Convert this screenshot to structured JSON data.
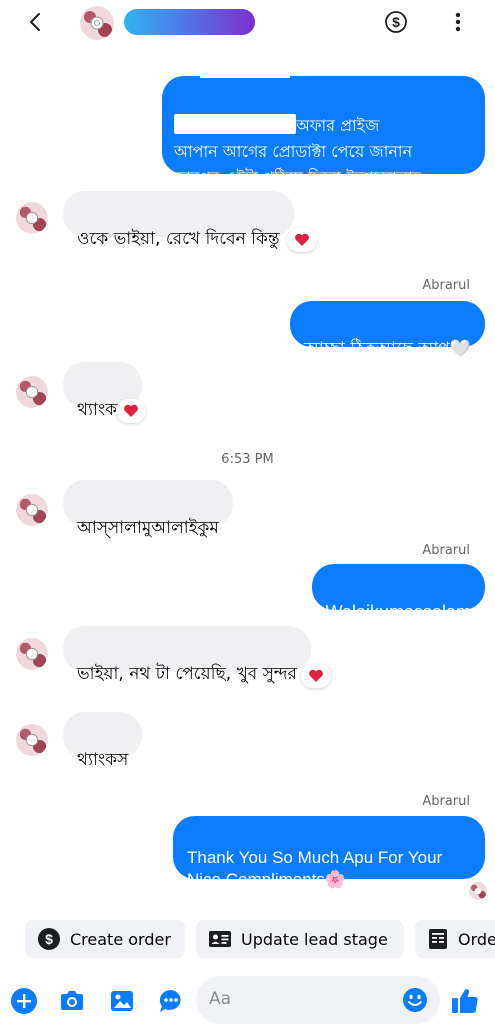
{
  "header": {
    "back_icon": "chevron-left-icon",
    "payment_icon": "dollar-circle-icon",
    "menu_icon": "more-vertical-icon"
  },
  "messages": [
    {
      "id": "m1",
      "side": "out",
      "text": "অফার প্রাইজ\nআপান আগের প্রোডাক্টা পেয়ে জানান\nতারপর এইটা পঠিয়ে দিবো ইনশাআল্লাহ"
    },
    {
      "id": "m2",
      "side": "in",
      "text": "ওকে ভাইয়া, রেখে দিবেন কিন্তু",
      "reaction": "❤️"
    },
    {
      "id": "m3",
      "side": "out",
      "sender": "Abrarul",
      "text": "আচ্ছা ঠিকআছে আপু🤍"
    },
    {
      "id": "m4",
      "side": "in",
      "text": "থ্যাংকস",
      "reaction": "❤️"
    },
    {
      "id": "ts",
      "timestamp": "6:53 PM"
    },
    {
      "id": "m5",
      "side": "in",
      "text": "আস্সালামুআলাইকুম"
    },
    {
      "id": "m6",
      "side": "out",
      "sender": "Abrarul",
      "text": "Walaikumassalam"
    },
    {
      "id": "m7",
      "side": "in",
      "text": "ভাইয়া, নথ টা পেয়েছি, খুব সুন্দর",
      "reaction": "❤️"
    },
    {
      "id": "m8",
      "side": "in",
      "text": "থ্যাংকস"
    },
    {
      "id": "m9",
      "side": "out",
      "sender": "Abrarul",
      "text": "Thank You So Much Apu For Your\nNice Compliments🌸"
    }
  ],
  "quick_actions": [
    {
      "label": "Create order",
      "icon": "dollar-circle-icon"
    },
    {
      "label": "Update lead stage",
      "icon": "contact-card-icon"
    },
    {
      "label": "Orde",
      "icon": "receipt-icon"
    }
  ],
  "composer": {
    "placeholder": "Aa",
    "icons": [
      "plus-icon",
      "camera-icon",
      "gallery-icon",
      "chat-bubble-icon",
      "emoji-icon",
      "thumbs-up-icon"
    ]
  },
  "colors": {
    "outgoing_bubble": "#0a7cff",
    "incoming_bubble": "#f0f0f2",
    "reaction_heart": "#e41e3f"
  }
}
